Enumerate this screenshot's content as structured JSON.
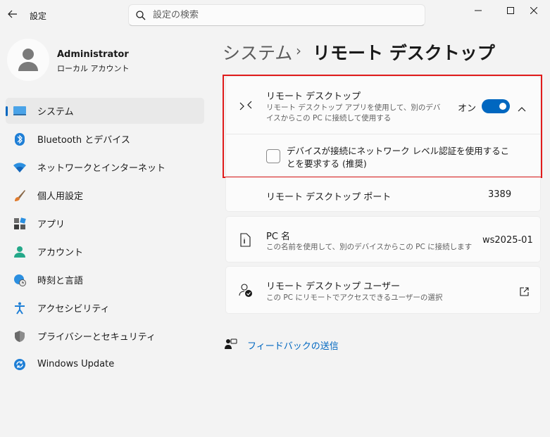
{
  "window": {
    "app_title": "設定",
    "search_placeholder": "設定の検索"
  },
  "profile": {
    "name": "Administrator",
    "account_type": "ローカル アカウント"
  },
  "sidebar": {
    "items": [
      {
        "label": "システム",
        "icon": "system-icon",
        "active": true
      },
      {
        "label": "Bluetooth とデバイス",
        "icon": "bluetooth-icon"
      },
      {
        "label": "ネットワークとインターネット",
        "icon": "wifi-icon"
      },
      {
        "label": "個人用設定",
        "icon": "brush-icon"
      },
      {
        "label": "アプリ",
        "icon": "apps-icon"
      },
      {
        "label": "アカウント",
        "icon": "person-icon"
      },
      {
        "label": "時刻と言語",
        "icon": "globe-clock-icon"
      },
      {
        "label": "アクセシビリティ",
        "icon": "accessibility-icon"
      },
      {
        "label": "プライバシーとセキュリティ",
        "icon": "shield-icon"
      },
      {
        "label": "Windows Update",
        "icon": "update-icon"
      }
    ]
  },
  "header": {
    "parent": "システム",
    "separator": "›",
    "current": "リモート デスクトップ"
  },
  "remote_desktop": {
    "title": "リモート デスクトップ",
    "description": "リモート デスクトップ アプリを使用して、別のデバイスからこの PC に接続して使用する",
    "state_label": "オン",
    "enabled": true,
    "nla_label": "デバイスが接続にネットワーク レベル認証を使用することを要求する (推奨)",
    "nla_checked": false
  },
  "port": {
    "label": "リモート デスクトップ ポート",
    "value": "3389"
  },
  "pc_name": {
    "title": "PC 名",
    "description": "この名前を使用して、別のデバイスからこの PC に接続します",
    "value": "ws2025-01"
  },
  "users": {
    "title": "リモート デスクトップ ユーザー",
    "description": "この PC にリモートでアクセスできるユーザーの選択"
  },
  "feedback": {
    "label": "フィードバックの送信"
  },
  "colors": {
    "accent": "#0067c0",
    "highlight": "#e01b1b",
    "background": "#f3f3f3",
    "card": "#fbfbfb"
  }
}
